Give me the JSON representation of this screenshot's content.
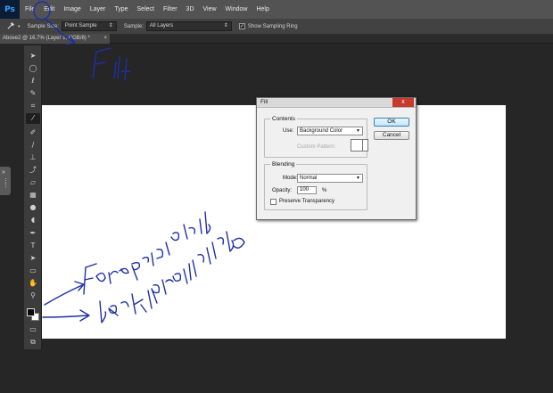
{
  "app": {
    "logo": "Ps",
    "menu": [
      "File",
      "Edit",
      "Image",
      "Layer",
      "Type",
      "Select",
      "Filter",
      "3D",
      "View",
      "Window",
      "Help"
    ]
  },
  "options_bar": {
    "tool_icon": "eyedropper-icon",
    "sample_size_label": "Sample Size:",
    "sample_size_value": "Point Sample",
    "sample_label": "Sample:",
    "sample_value": "All Layers",
    "show_ring_checked": true,
    "show_ring_label": "Show Sampling Ring"
  },
  "document_tab": {
    "label": "Above2 @ 16.7% (Layer 1, RGB/8) *",
    "close": "×"
  },
  "fill_dialog": {
    "title": "Fill",
    "close": "x",
    "contents_group": "Contents",
    "use_label": "Use:",
    "use_value": "Background Color",
    "custom_pattern_label": "Custom Pattern:",
    "blending_group": "Blending",
    "mode_label": "Mode:",
    "mode_value": "Normal",
    "opacity_label": "Opacity:",
    "opacity_value": "100",
    "opacity_unit": "%",
    "preserve_transparency_label": "Preserve Transparency",
    "preserve_transparency_checked": false,
    "ok_label": "OK",
    "cancel_label": "Cancel"
  },
  "colors": {
    "foreground": "#000000",
    "background": "#ffffff"
  },
  "annotations": {
    "fill_note": "Fill",
    "foreground_note": "Foreground",
    "background_note": "background",
    "ink_color": "#1d2ea8"
  }
}
